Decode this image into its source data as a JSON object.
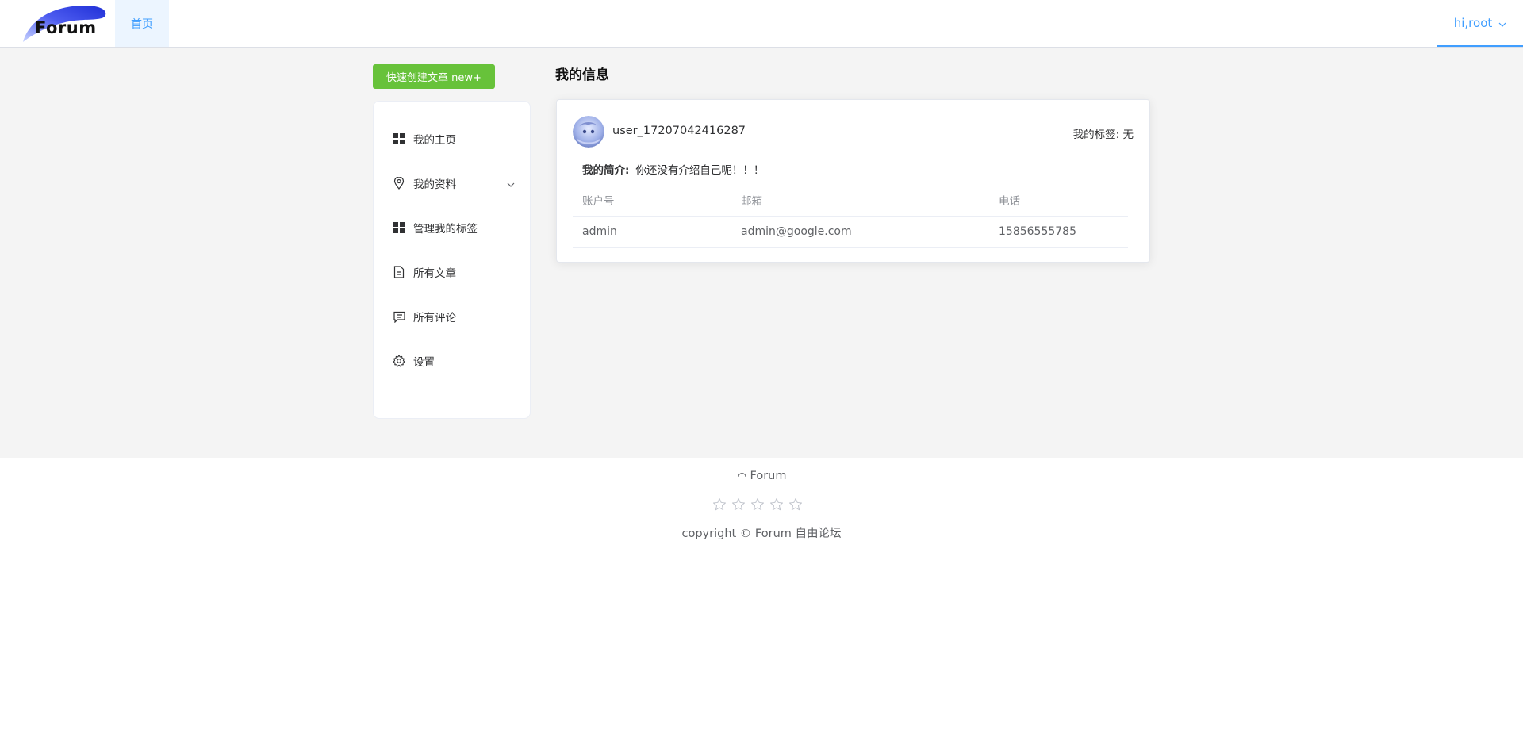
{
  "header": {
    "logo_text": "Forum",
    "nav_home": "首页",
    "user_greeting": "hi,root"
  },
  "actions": {
    "quick_create": "快速创建文章 new+"
  },
  "sidebar": {
    "items": [
      {
        "label": "我的主页",
        "icon": "grid-icon"
      },
      {
        "label": "我的资料",
        "icon": "location-icon"
      },
      {
        "label": "管理我的标签",
        "icon": "grid-icon"
      },
      {
        "label": "所有文章",
        "icon": "document-icon"
      },
      {
        "label": "所有评论",
        "icon": "chat-icon"
      },
      {
        "label": "设置",
        "icon": "gear-icon"
      }
    ]
  },
  "main": {
    "title": "我的信息",
    "username": "user_17207042416287",
    "tags_label": "我的标签: 无",
    "intro_label": "我的简介:",
    "intro_text": "你还没有介绍自己呢！！！",
    "table": {
      "headers": [
        "账户号",
        "邮箱",
        "电话"
      ],
      "rows": [
        [
          "admin",
          "admin@google.com",
          "15856555785"
        ]
      ]
    }
  },
  "footer": {
    "title": "Forum",
    "copyright": "copyright © Forum 自由论坛",
    "rating": 0,
    "rating_max": 5
  },
  "colors": {
    "accent": "#409eff",
    "success": "#67c23a",
    "page_bg": "#f4f4f4"
  }
}
